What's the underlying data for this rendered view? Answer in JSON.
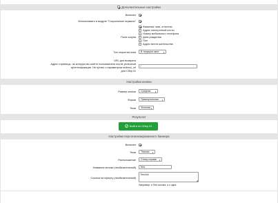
{
  "section_additional": {
    "title": "Дополнительные настройки",
    "enabled_label": "Включен",
    "enabled": true,
    "social_module_label": "Использовать в модуле \"Социальные сервисы\"",
    "social_module": true,
    "fields_label": "Поля скоупа",
    "fields": [
      {
        "label": "Фамилия, имя, отчество",
        "checked": true
      },
      {
        "label": "Адрес электронной почты",
        "checked": false
      },
      {
        "label": "Номер мобильного телефона",
        "checked": false
      },
      {
        "label": "Дата рождения",
        "checked": false
      },
      {
        "label": "Пол",
        "checked": false
      },
      {
        "label": "Адрес места жительства",
        "checked": false
      }
    ],
    "window_type_label": "Тип открытия окна",
    "window_type_value": "В текущем окне",
    "return_url_label": "URL для возврата",
    "redirect_label_lines": [
      "Адрес страницы, на которую вы шлёте пользователя после успешной",
      "аутентификации. Не путать с параметром redirect_uri",
      "для Сбер ID"
    ],
    "redirect_value": "/"
  },
  "section_button": {
    "title": "Настройка кнопки",
    "size_label": "Размер кнопки",
    "size_value": "Средняя",
    "shape_label": "Форма",
    "shape_value": "Прямоугольная",
    "theme_label": "Тема",
    "theme_value": "Зеленая"
  },
  "section_result": {
    "title": "Результат",
    "button_text": "Войти по Сбер ID"
  },
  "section_banner": {
    "title": "Настройки персонализированного баннера",
    "enabled_label": "Включен",
    "enabled": true,
    "theme_label": "Тема",
    "theme_value": "Темная",
    "position_label": "Расположение",
    "position_value": "Снизу-справа",
    "title_label": "Название кнопки (необязательный)",
    "title_value": "Test",
    "offer_label": "Ссылка на оферту (необязательный)",
    "offer_value": "Test link",
    "note": "Например: в Test ссылка, а о одна."
  },
  "colors": {
    "header_bg": "#e5e5e5",
    "sber_green": "#21a038"
  }
}
